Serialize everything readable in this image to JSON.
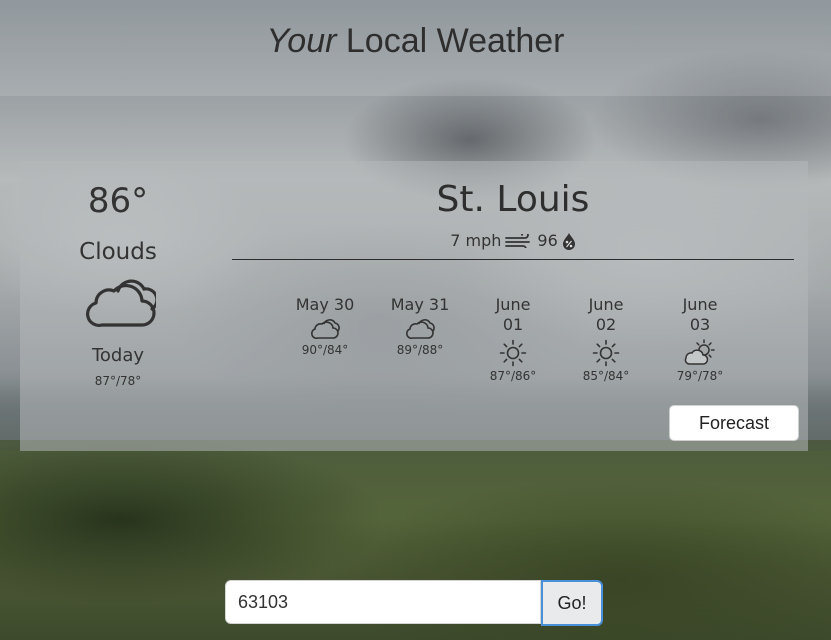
{
  "header": {
    "title_italic": "Your",
    "title_rest": " Local Weather"
  },
  "current": {
    "temp": "86°",
    "condition": "Clouds",
    "icon": "cloud-icon",
    "today_label": "Today",
    "today_range": "87°/78°",
    "city": "St. Louis",
    "wind": "7 mph",
    "humidity": "96",
    "wind_icon": "wind-icon",
    "humidity_icon": "humidity-drop-icon"
  },
  "days": [
    {
      "label": "May 30",
      "icon": "cloud-icon",
      "range": "90°/84°"
    },
    {
      "label": "May 31",
      "icon": "cloud-icon",
      "range": "89°/88°"
    },
    {
      "label": "June 01",
      "icon": "sun-icon",
      "range": "87°/86°"
    },
    {
      "label": "June 02",
      "icon": "sun-icon",
      "range": "85°/84°"
    },
    {
      "label": "June 03",
      "icon": "partly-cloudy-icon",
      "range": "79°/78°"
    }
  ],
  "forecast_button": "Forecast",
  "search": {
    "value": "63103",
    "go_label": "Go!"
  }
}
